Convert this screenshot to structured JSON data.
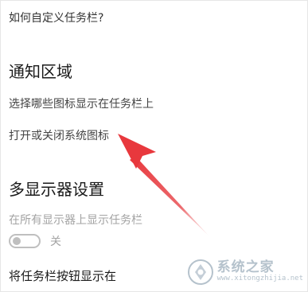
{
  "help_link": "如何自定义任务栏?",
  "notification_area": {
    "title": "通知区域",
    "select_icons_link": "选择哪些图标显示在任务栏上",
    "system_icons_link": "打开或关闭系统图标"
  },
  "multi_display": {
    "title": "多显示器设置",
    "show_taskbar_label": "在所有显示器上显示任务栏",
    "toggle_state": "关",
    "toggle_on": false,
    "taskbar_buttons_label": "将任务栏按钮显示在"
  },
  "annotation": {
    "arrow_color": "#e8383d"
  },
  "watermark": {
    "name": "系统之家",
    "url": "www.xitongzhijia.net"
  }
}
